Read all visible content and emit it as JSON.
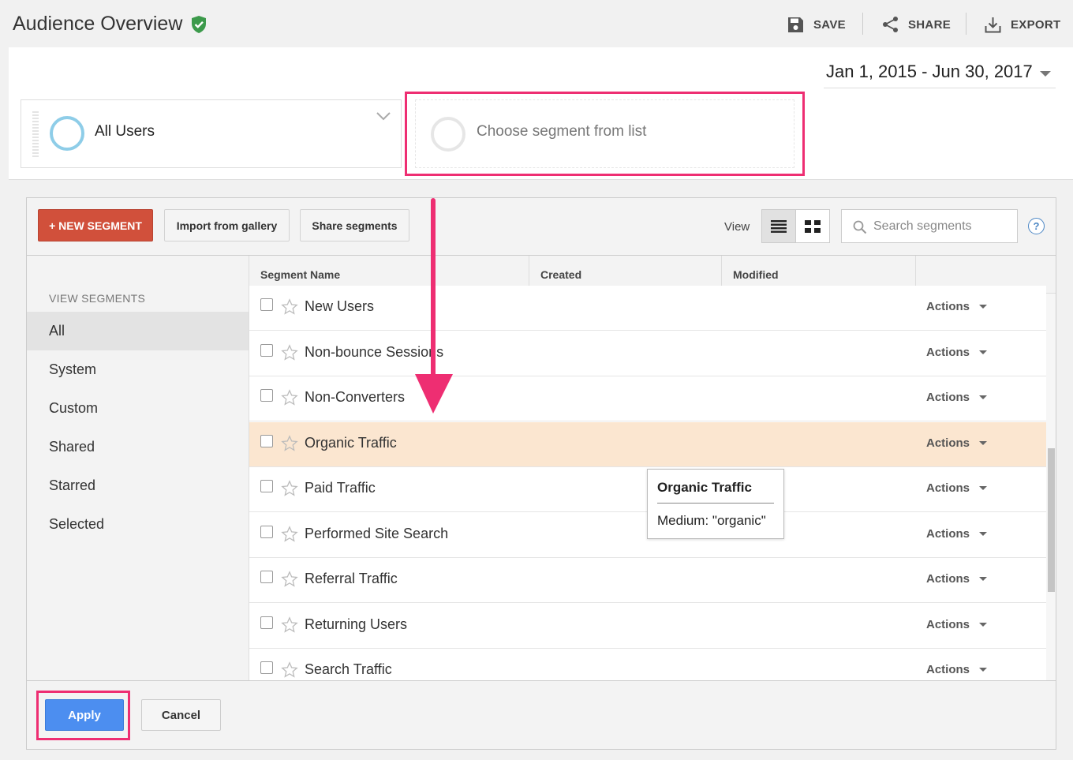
{
  "header": {
    "title": "Audience Overview",
    "save_label": "SAVE",
    "share_label": "SHARE",
    "export_label": "EXPORT"
  },
  "date_range": "Jan 1, 2015 - Jun 30, 2017",
  "segments": {
    "selected": "All Users",
    "choose_placeholder": "Choose segment from list"
  },
  "toolbar": {
    "new_segment": "+ NEW SEGMENT",
    "import_gallery": "Import from gallery",
    "share_segments": "Share segments",
    "view_label": "View",
    "search_placeholder": "Search segments",
    "help": "?"
  },
  "sidebar": {
    "heading": "VIEW SEGMENTS",
    "items": [
      "All",
      "System",
      "Custom",
      "Shared",
      "Starred",
      "Selected"
    ]
  },
  "table": {
    "columns": [
      "Segment Name",
      "Created",
      "Modified"
    ],
    "actions_label": "Actions",
    "rows": [
      {
        "name": "New Users"
      },
      {
        "name": "Non-bounce Sessions"
      },
      {
        "name": "Non-Converters"
      },
      {
        "name": "Organic Traffic"
      },
      {
        "name": "Paid Traffic"
      },
      {
        "name": "Performed Site Search"
      },
      {
        "name": "Referral Traffic"
      },
      {
        "name": "Returning Users"
      },
      {
        "name": "Search Traffic"
      }
    ]
  },
  "tooltip": {
    "title": "Organic Traffic",
    "body": "Medium: \"organic\""
  },
  "footer": {
    "apply": "Apply",
    "cancel": "Cancel"
  },
  "colors": {
    "highlight_box": "#ee2e72",
    "new_segment_button": "#d1503b",
    "apply_button": "#4c8ef0",
    "highlighted_row": "#fbe6d0",
    "verified_shield": "#3c9a4b"
  }
}
